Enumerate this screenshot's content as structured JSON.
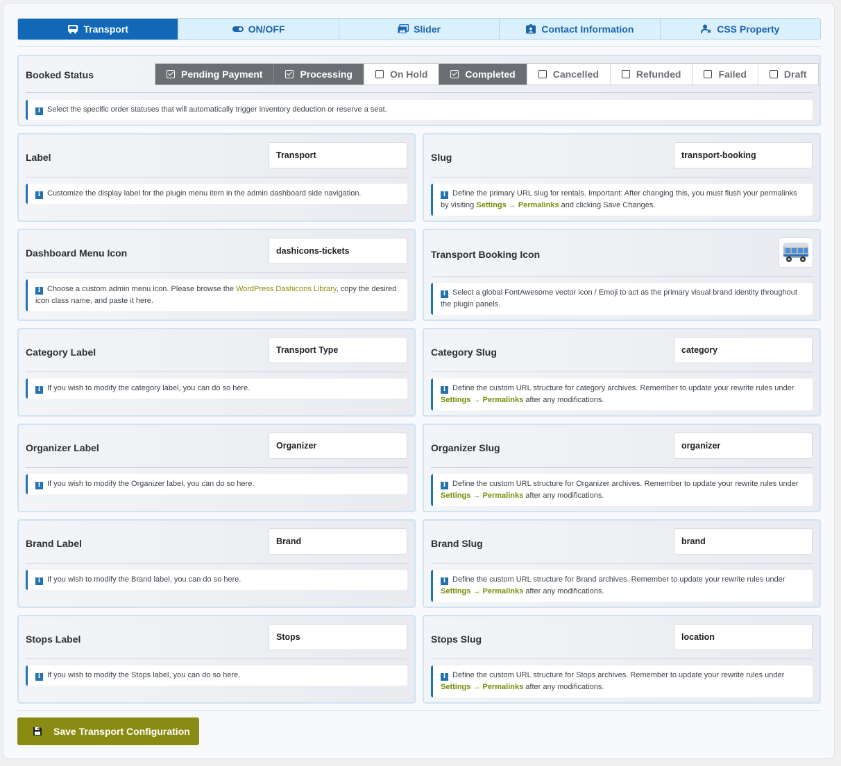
{
  "tabs": [
    {
      "label": "Transport",
      "icon": "bus-icon",
      "active": true
    },
    {
      "label": "ON/OFF",
      "icon": "toggle-icon",
      "active": false
    },
    {
      "label": "Slider",
      "icon": "images-icon",
      "active": false
    },
    {
      "label": "Contact Information",
      "icon": "id-card-icon",
      "active": false
    },
    {
      "label": "CSS Property",
      "icon": "code-icon",
      "active": false
    }
  ],
  "booked_status": {
    "label": "Booked Status",
    "options": [
      {
        "label": "Pending Payment",
        "checked": true
      },
      {
        "label": "Processing",
        "checked": true
      },
      {
        "label": "On Hold",
        "checked": false
      },
      {
        "label": "Completed",
        "checked": true
      },
      {
        "label": "Cancelled",
        "checked": false
      },
      {
        "label": "Refunded",
        "checked": false
      },
      {
        "label": "Failed",
        "checked": false
      },
      {
        "label": "Draft",
        "checked": false
      }
    ],
    "info": "Select the specific order statuses that will automatically trigger inventory deduction or reserve a seat."
  },
  "label_field": {
    "label": "Label",
    "value": "Transport",
    "info": "Customize the display label for the plugin menu item in the admin dashboard side navigation."
  },
  "slug_field": {
    "label": "Slug",
    "value": "transport-booking",
    "info_pre": "Define the primary URL slug for rentals. Important: After changing this, you must flush your permalinks by visiting ",
    "info_link": "Settings → Permalinks",
    "info_post": " and clicking Save Changes."
  },
  "menu_icon_field": {
    "label": "Dashboard Menu Icon",
    "value": "dashicons-tickets",
    "info_pre": "Choose a custom admin menu icon. Please browse the ",
    "info_link": "WordPress Dashicons Library",
    "info_post": ", copy the desired icon class name, and paste it here."
  },
  "booking_icon_field": {
    "label": "Transport Booking Icon",
    "icon": "bus-emoji-icon",
    "info": "Select a global FontAwesome vector icon / Emoji to act as the primary visual brand identity throughout the plugin panels."
  },
  "category_label_field": {
    "label": "Category Label",
    "value": "Transport Type",
    "info": "If you wish to modify the category label, you can do so here."
  },
  "category_slug_field": {
    "label": "Category Slug",
    "value": "category",
    "info_pre": "Define the custom URL structure for category archives. Remember to update your rewrite rules under ",
    "info_link": "Settings → Permalinks",
    "info_post": " after any modifications."
  },
  "organizer_label_field": {
    "label": "Organizer Label",
    "value": "Organizer",
    "info": "If you wish to modify the Organizer label, you can do so here."
  },
  "organizer_slug_field": {
    "label": "Organizer Slug",
    "value": "organizer",
    "info_pre": "Define the custom URL structure for Organizer archives. Remember to update your rewrite rules under ",
    "info_link": "Settings → Permalinks",
    "info_post": " after any modifications."
  },
  "brand_label_field": {
    "label": "Brand Label",
    "value": "Brand",
    "info": "If you wish to modify the Brand label, you can do so here."
  },
  "brand_slug_field": {
    "label": "Brand Slug",
    "value": "brand",
    "info_pre": "Define the custom URL structure for Brand archives. Remember to update your rewrite rules under ",
    "info_link": "Settings → Permalinks",
    "info_post": " after any modifications."
  },
  "stops_label_field": {
    "label": "Stops Label",
    "value": "Stops",
    "info": "If you wish to modify the Stops label, you can do so here."
  },
  "stops_slug_field": {
    "label": "Stops Slug",
    "value": "location",
    "info_pre": "Define the custom URL structure for Stops archives. Remember to update your rewrite rules under ",
    "info_link": "Settings → Permalinks",
    "info_post": " after any modifications."
  },
  "save_button": {
    "label": "Save Transport Configuration",
    "icon": "floppy-disk-icon"
  },
  "colors": {
    "accent": "#1268b7",
    "tab_bg": "#daf0fd",
    "save": "#8a8b12",
    "link": "#7a8a06"
  }
}
